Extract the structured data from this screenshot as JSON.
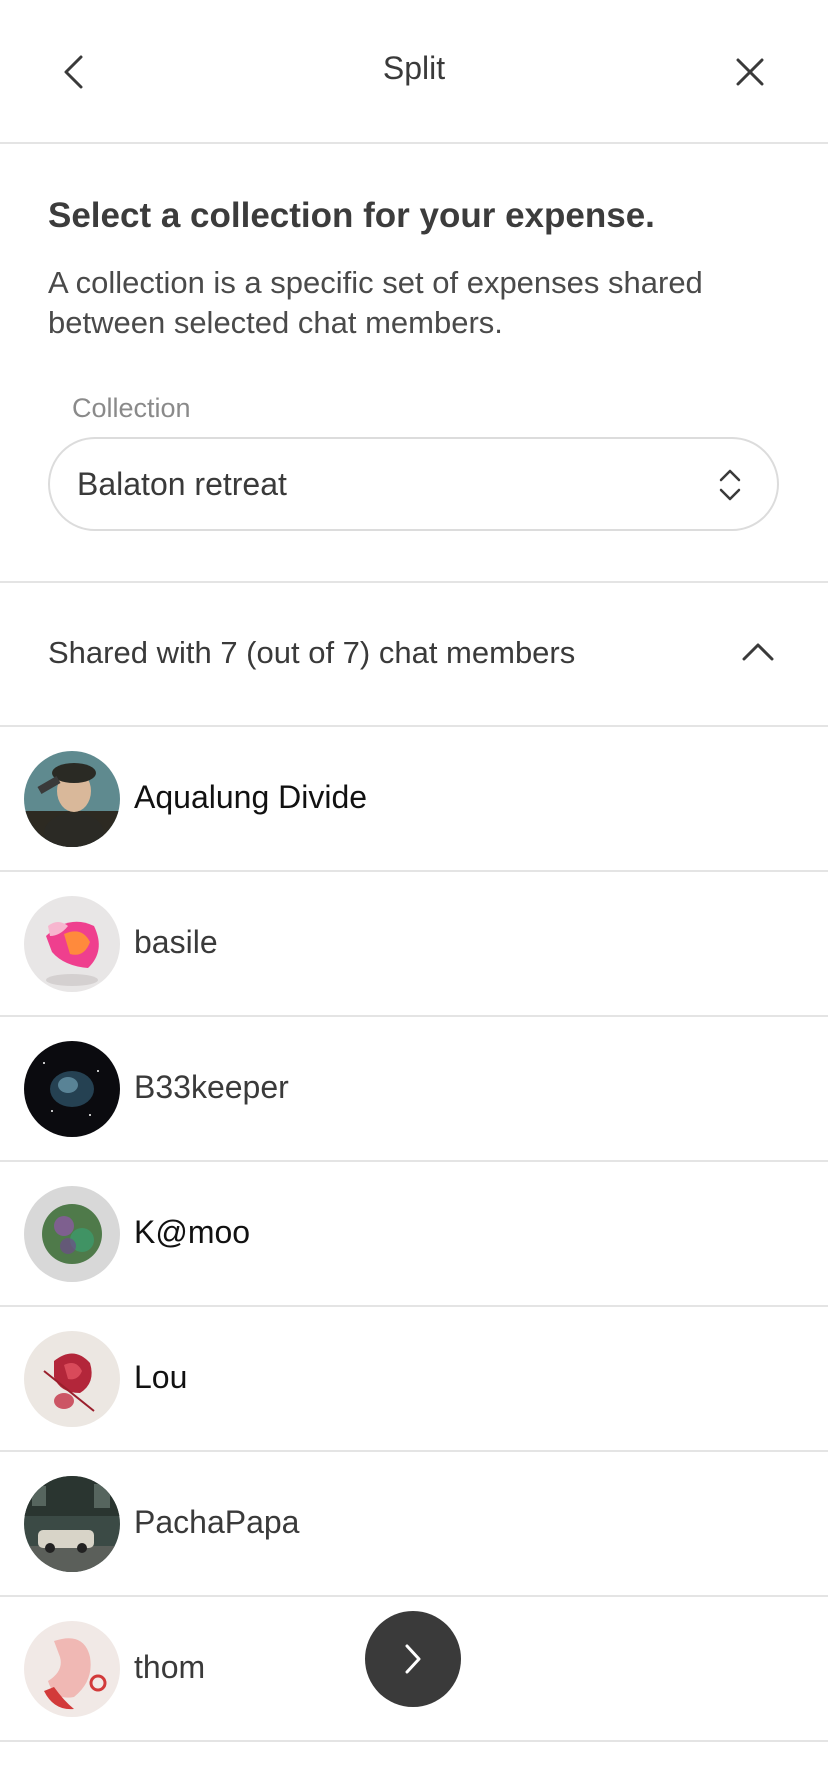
{
  "header": {
    "title": "Split",
    "back_icon": "chevron-left-icon",
    "close_icon": "close-icon"
  },
  "intro": {
    "heading": "Select a collection for your expense.",
    "description": "A collection is a specific set of expenses shared between selected chat members."
  },
  "collection": {
    "label": "Collection",
    "selected": "Balaton retreat",
    "icon": "updown-chevron-icon"
  },
  "shared": {
    "label": "Shared with 7 (out of 7) chat members",
    "icon": "chevron-up-icon"
  },
  "members": [
    {
      "name": "Aqualung Divide"
    },
    {
      "name": "basile"
    },
    {
      "name": "B33keeper"
    },
    {
      "name": "K@moo"
    },
    {
      "name": "Lou"
    },
    {
      "name": "PachaPapa"
    },
    {
      "name": "thom"
    }
  ],
  "fab": {
    "icon": "chevron-right-icon"
  },
  "colors": {
    "fab_background": "#3a3a3a",
    "divider": "#e4e4e4",
    "text": "#3a3a3a"
  }
}
